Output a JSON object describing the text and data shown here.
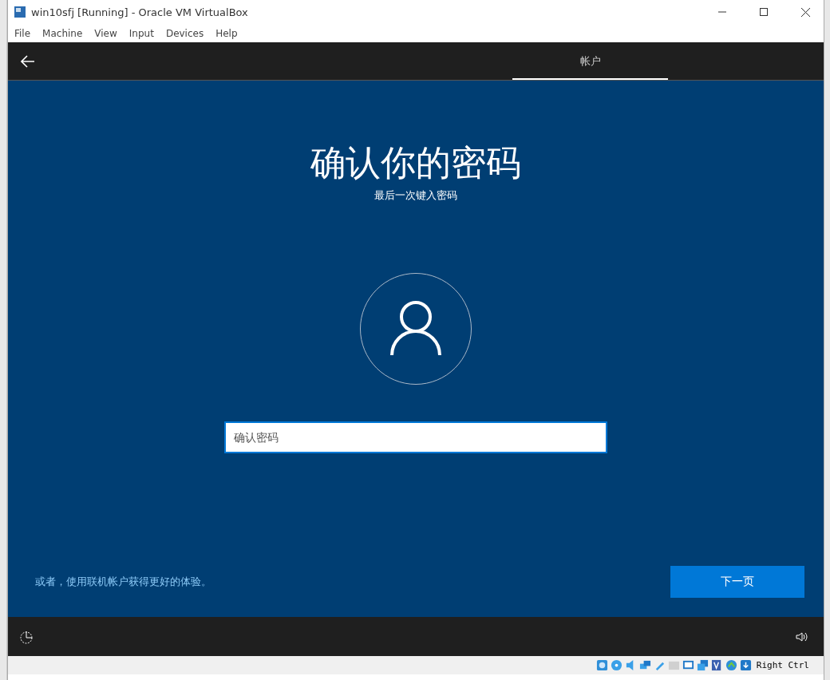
{
  "window": {
    "title": "win10sfj [Running] - Oracle VM VirtualBox"
  },
  "menu": [
    "File",
    "Machine",
    "View",
    "Input",
    "Devices",
    "Help"
  ],
  "guest": {
    "header_tabs": [
      {
        "label": "帐户",
        "selected": true
      }
    ],
    "heading": "确认你的密码",
    "subheading": "最后一次键入密码",
    "password_field": {
      "placeholder": "确认密码"
    },
    "online_account_link": "或者，使用联机帐户获得更好的体验。",
    "next_button": "下一页"
  },
  "status_bar": {
    "host_key": "Right Ctrl"
  }
}
